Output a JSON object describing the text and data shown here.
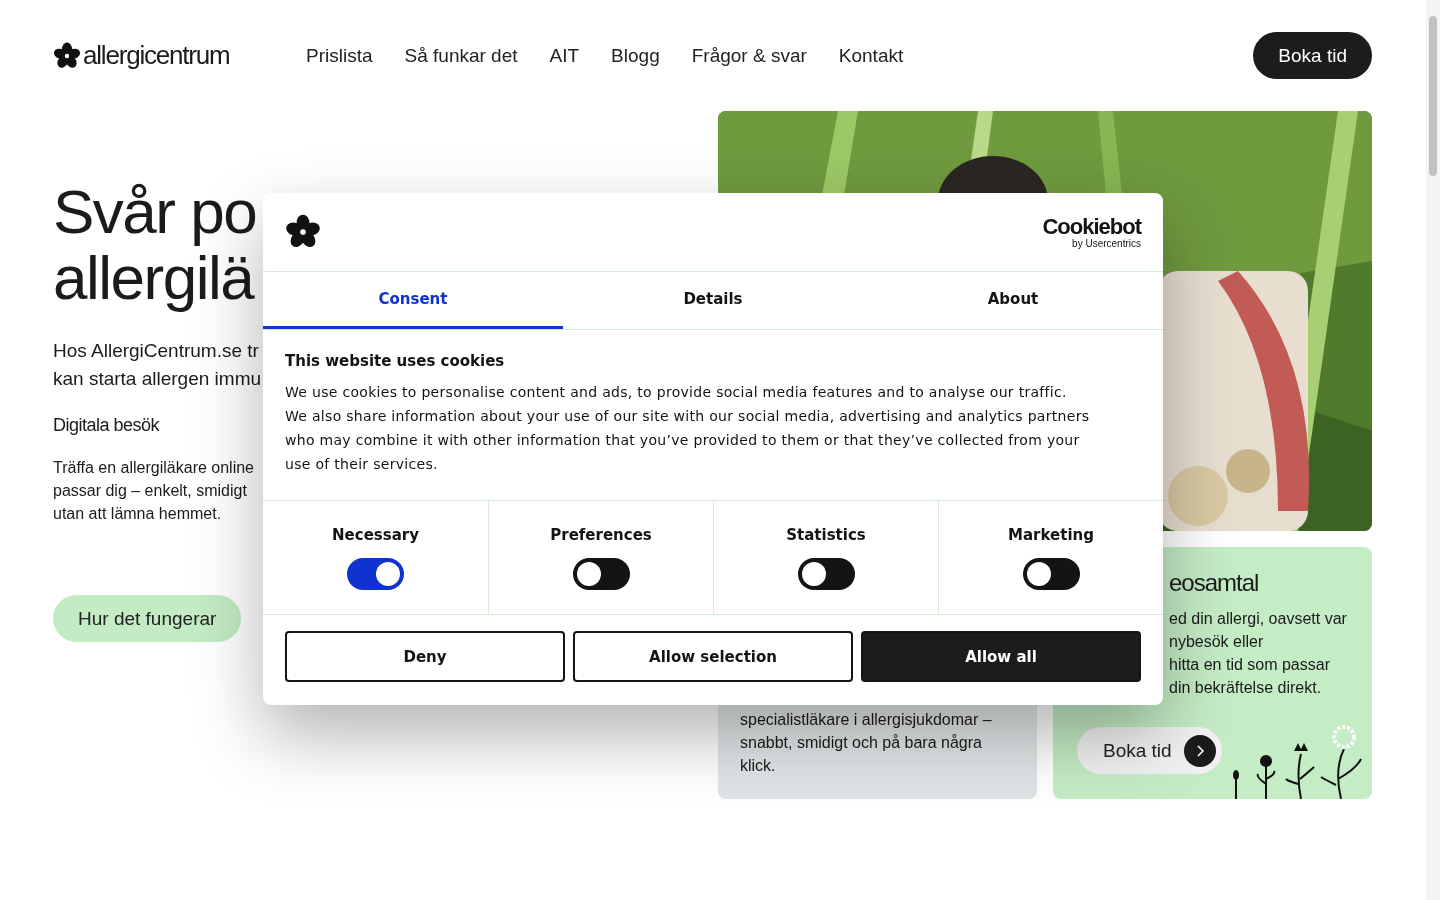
{
  "header": {
    "logo": "allergicentrum",
    "nav": [
      "Prislista",
      "Så funkar det",
      "AIT",
      "Blogg",
      "Frågor & svar",
      "Kontakt"
    ],
    "cta": "Boka tid"
  },
  "hero": {
    "title_lines": [
      "Svår po",
      "allergilä"
    ],
    "intro_lines": [
      "Hos AllergiCentrum.se tr",
      "kan starta allergen immu"
    ],
    "subheading": "Digitala besök",
    "body_lines": [
      "Träffa en allergiläkare online",
      "passar dig – enkelt, smidigt",
      "utan att lämna hemmet."
    ],
    "button": "Hur det fungerar"
  },
  "card_left": {
    "lines": [
      "specialistläkare i allergisjukdomar –",
      "snabbt, smidigt och på bara några",
      "klick."
    ]
  },
  "card_right": {
    "title": "eosamtal",
    "lines": [
      "ed din allergi, oavsett var",
      "nybesök eller",
      "hitta en tid som passar",
      "din bekräftelse direkt."
    ],
    "button": "Boka tid"
  },
  "consent": {
    "brand": "Cookiebot",
    "brand_sub": "by Usercentrics",
    "tabs": [
      {
        "label": "Consent",
        "selected": true
      },
      {
        "label": "Details",
        "selected": false
      },
      {
        "label": "About",
        "selected": false
      }
    ],
    "heading": "This website uses cookies",
    "text": "We use cookies to personalise content and ads, to provide social media features and to analyse our traffic. We also share information about your use of our site with our social media, advertising and analytics partners who may combine it with other information that you’ve provided to them or that they’ve collected from your use of their services.",
    "categories": [
      {
        "label": "Necessary",
        "on": true
      },
      {
        "label": "Preferences",
        "on": false
      },
      {
        "label": "Statistics",
        "on": false
      },
      {
        "label": "Marketing",
        "on": false
      }
    ],
    "buttons": [
      {
        "label": "Deny",
        "kind": "outline"
      },
      {
        "label": "Allow selection",
        "kind": "outline"
      },
      {
        "label": "Allow all",
        "kind": "filled"
      }
    ]
  }
}
